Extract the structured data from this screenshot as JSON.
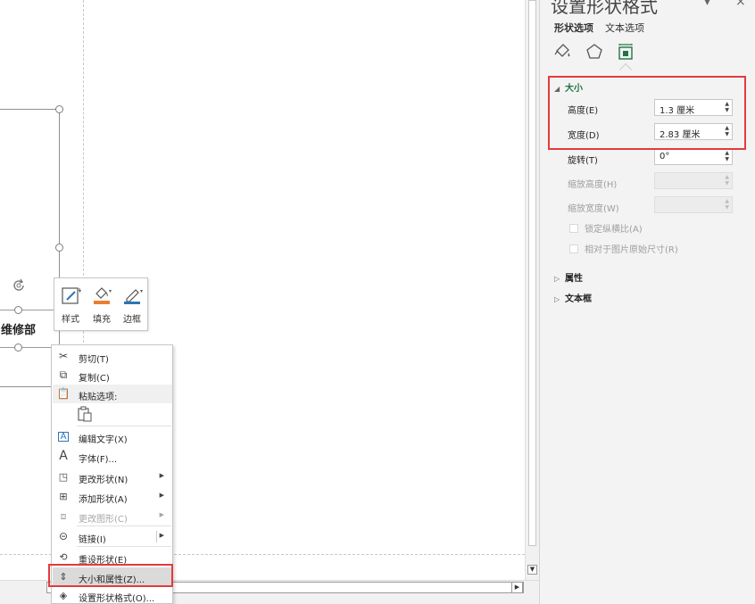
{
  "window": {
    "title": "设置形状格式"
  },
  "panel": {
    "title": "设置形状格式",
    "tabs": [
      {
        "label": "形状选项",
        "active": true
      },
      {
        "label": "文本选项",
        "active": false
      }
    ],
    "category_icons": [
      "fill-line-icon",
      "effects-icon",
      "size-properties-icon"
    ],
    "size_section": {
      "label": "大小",
      "height_label": "高度(E)",
      "height_value": "1.3 厘米",
      "width_label": "宽度(D)",
      "width_value": "2.83 厘米",
      "rotation_label": "旋转(T)",
      "rotation_value": "0°",
      "scale_height_label": "缩放高度(H)",
      "scale_width_label": "缩放宽度(W)",
      "lock_aspect_label": "锁定纵横比(A)",
      "relative_label": "相对于图片原始尺寸(R)"
    },
    "properties_section": {
      "label": "属性"
    },
    "textbox_section": {
      "label": "文本框"
    }
  },
  "canvas": {
    "shape_text": "维修部"
  },
  "mini_toolbar": {
    "style_label": "样式",
    "fill_label": "填充",
    "outline_label": "边框"
  },
  "context_menu": {
    "items": [
      {
        "label": "剪切(T)",
        "icon": "scissors-icon"
      },
      {
        "label": "复制(C)",
        "icon": "copy-icon"
      },
      {
        "label": "粘贴选项:",
        "icon": "paste-icon"
      },
      {
        "label": "编辑文字(X)",
        "icon": "edit-text-icon"
      },
      {
        "label": "字体(F)...",
        "icon": "font-icon"
      },
      {
        "label": "更改形状(N)",
        "icon": "change-shape-icon"
      },
      {
        "label": "添加形状(A)",
        "icon": "add-shape-icon"
      },
      {
        "label": "更改图形(C)",
        "icon": "change-graphic-icon"
      },
      {
        "label": "链接(I)",
        "icon": "link-icon"
      },
      {
        "label": "重设形状(E)",
        "icon": "reset-shape-icon"
      },
      {
        "label": "大小和属性(Z)...",
        "icon": "size-position-icon"
      },
      {
        "label": "设置形状格式(O)...",
        "icon": "format-shape-icon"
      }
    ]
  },
  "colors": {
    "highlight_box": "#e33b3b",
    "size_section_accent": "#217346",
    "fill_accent": "#ed7d31",
    "outline_accent": "#2e75b6"
  }
}
